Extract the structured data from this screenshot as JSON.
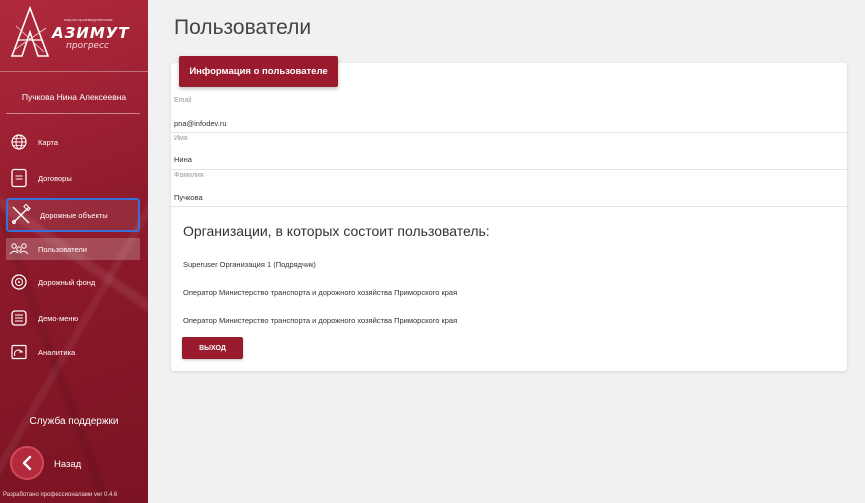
{
  "app": {
    "logo_title": "АЗИМУТ",
    "logo_subtitle": "прогресс",
    "logo_tagline": "научно-производственная"
  },
  "sidebar": {
    "user_name": "Пучкова Нина Алексеевна",
    "items": [
      {
        "label": "Карта",
        "icon": "globe-icon"
      },
      {
        "label": "Договоры",
        "icon": "document-icon"
      },
      {
        "label": "Дорожные объекты",
        "icon": "road-tools-icon"
      },
      {
        "label": "Пользователи",
        "icon": "users-icon"
      },
      {
        "label": "Дорожный фонд",
        "icon": "fund-icon"
      },
      {
        "label": "Демо-меню",
        "icon": "menu-list-icon"
      },
      {
        "label": "Аналитика",
        "icon": "analytics-icon"
      }
    ],
    "support_label": "Служба поддержки",
    "back_label": "Назад",
    "credits": "Разработано профессионалами ver 0.4.6"
  },
  "main": {
    "page_title": "Пользователи",
    "card_header": "Информация о пользователе",
    "fields": [
      {
        "label": "Email",
        "value": "pna@infodev.ru"
      },
      {
        "label": "Имя",
        "value": "Нина"
      },
      {
        "label": "Фамилия",
        "value": "Пучкова"
      }
    ],
    "orgs_title": "Организации, в которых состоит пользователь:",
    "orgs": [
      "Superuser Организация 1 (Подрядчик)",
      "Оператор Министерство транспорта и дорожного хозяйства Приморского края",
      "Оператор Министерство транспорта и дорожного хозяйства Приморского края"
    ],
    "logout_label": "ВЫХОД"
  },
  "colors": {
    "brand": "#9a1b2d",
    "sidebar_bg": "#8e1a2b",
    "highlight_border": "#3b6fd8",
    "page_bg": "#f1f1f1"
  }
}
